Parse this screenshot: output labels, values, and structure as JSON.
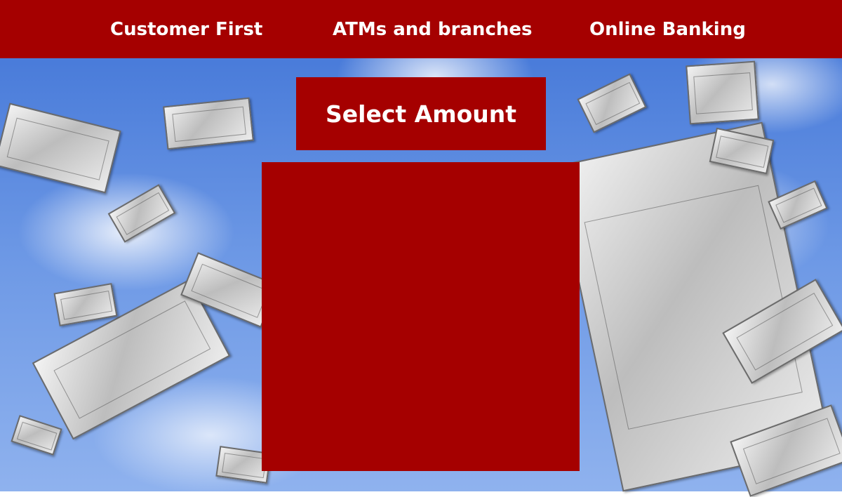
{
  "nav": {
    "items": [
      {
        "label": "Customer First"
      },
      {
        "label": "ATMs and branches"
      },
      {
        "label": "Online Banking"
      }
    ]
  },
  "amount_section": {
    "title": "Select Amount"
  },
  "colors": {
    "brand_red": "#a50000",
    "text_on_brand": "#ffffff",
    "sky_blue": "#4f80dd"
  },
  "background": {
    "description_icon": "falling-money-image"
  }
}
